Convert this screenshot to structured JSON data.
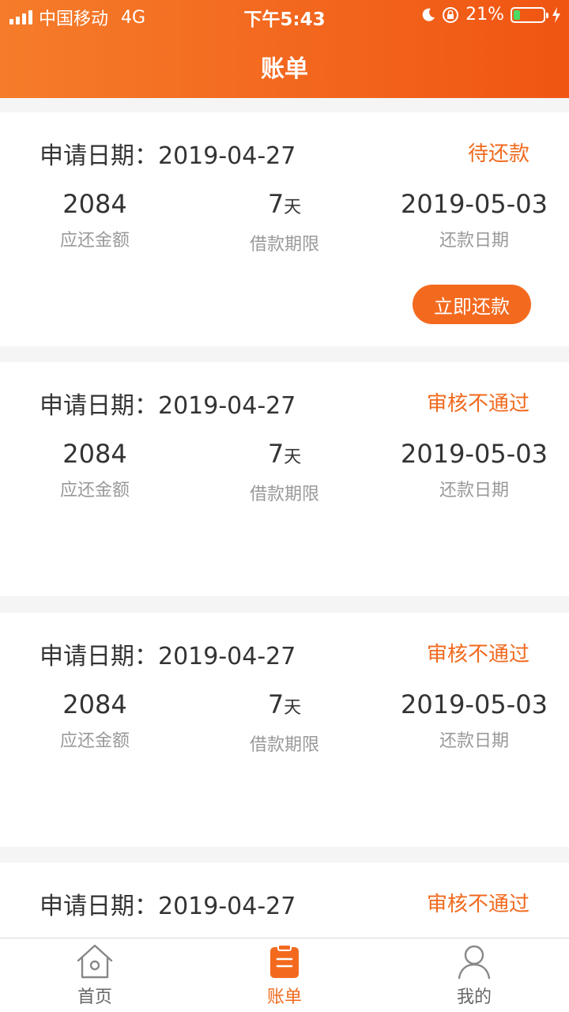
{
  "status_bar": {
    "carrier": "中国移动",
    "network": "4G",
    "time": "下午5:43",
    "battery": "21%",
    "battery_level": 0.21
  },
  "header": {
    "title": "账单"
  },
  "bills": [
    {
      "date_label": "申请日期：",
      "date": "2019-04-27",
      "status": "待还款",
      "amount": "2084",
      "amount_label": "应还金额",
      "term_value": "7",
      "term_unit": "天",
      "term_label": "借款期限",
      "due_date": "2019-05-03",
      "due_label": "还款日期",
      "action_label": "立即还款"
    },
    {
      "date_label": "申请日期：",
      "date": "2019-04-27",
      "status": "审核不通过",
      "amount": "2084",
      "amount_label": "应还金额",
      "term_value": "7",
      "term_unit": "天",
      "term_label": "借款期限",
      "due_date": "2019-05-03",
      "due_label": "还款日期"
    },
    {
      "date_label": "申请日期：",
      "date": "2019-04-27",
      "status": "审核不通过",
      "amount": "2084",
      "amount_label": "应还金额",
      "term_value": "7",
      "term_unit": "天",
      "term_label": "借款期限",
      "due_date": "2019-05-03",
      "due_label": "还款日期"
    },
    {
      "date_label": "申请日期：",
      "date": "2019-04-27",
      "status": "审核不通过"
    }
  ],
  "tabbar": {
    "items": [
      {
        "label": "首页",
        "icon": "home-icon",
        "active": false
      },
      {
        "label": "账单",
        "icon": "bill-icon",
        "active": true
      },
      {
        "label": "我的",
        "icon": "user-icon",
        "active": false
      }
    ]
  },
  "colors": {
    "accent": "#f06a1e",
    "header_start": "#f57c2a",
    "header_end": "#f05512",
    "muted_text": "#999999"
  }
}
